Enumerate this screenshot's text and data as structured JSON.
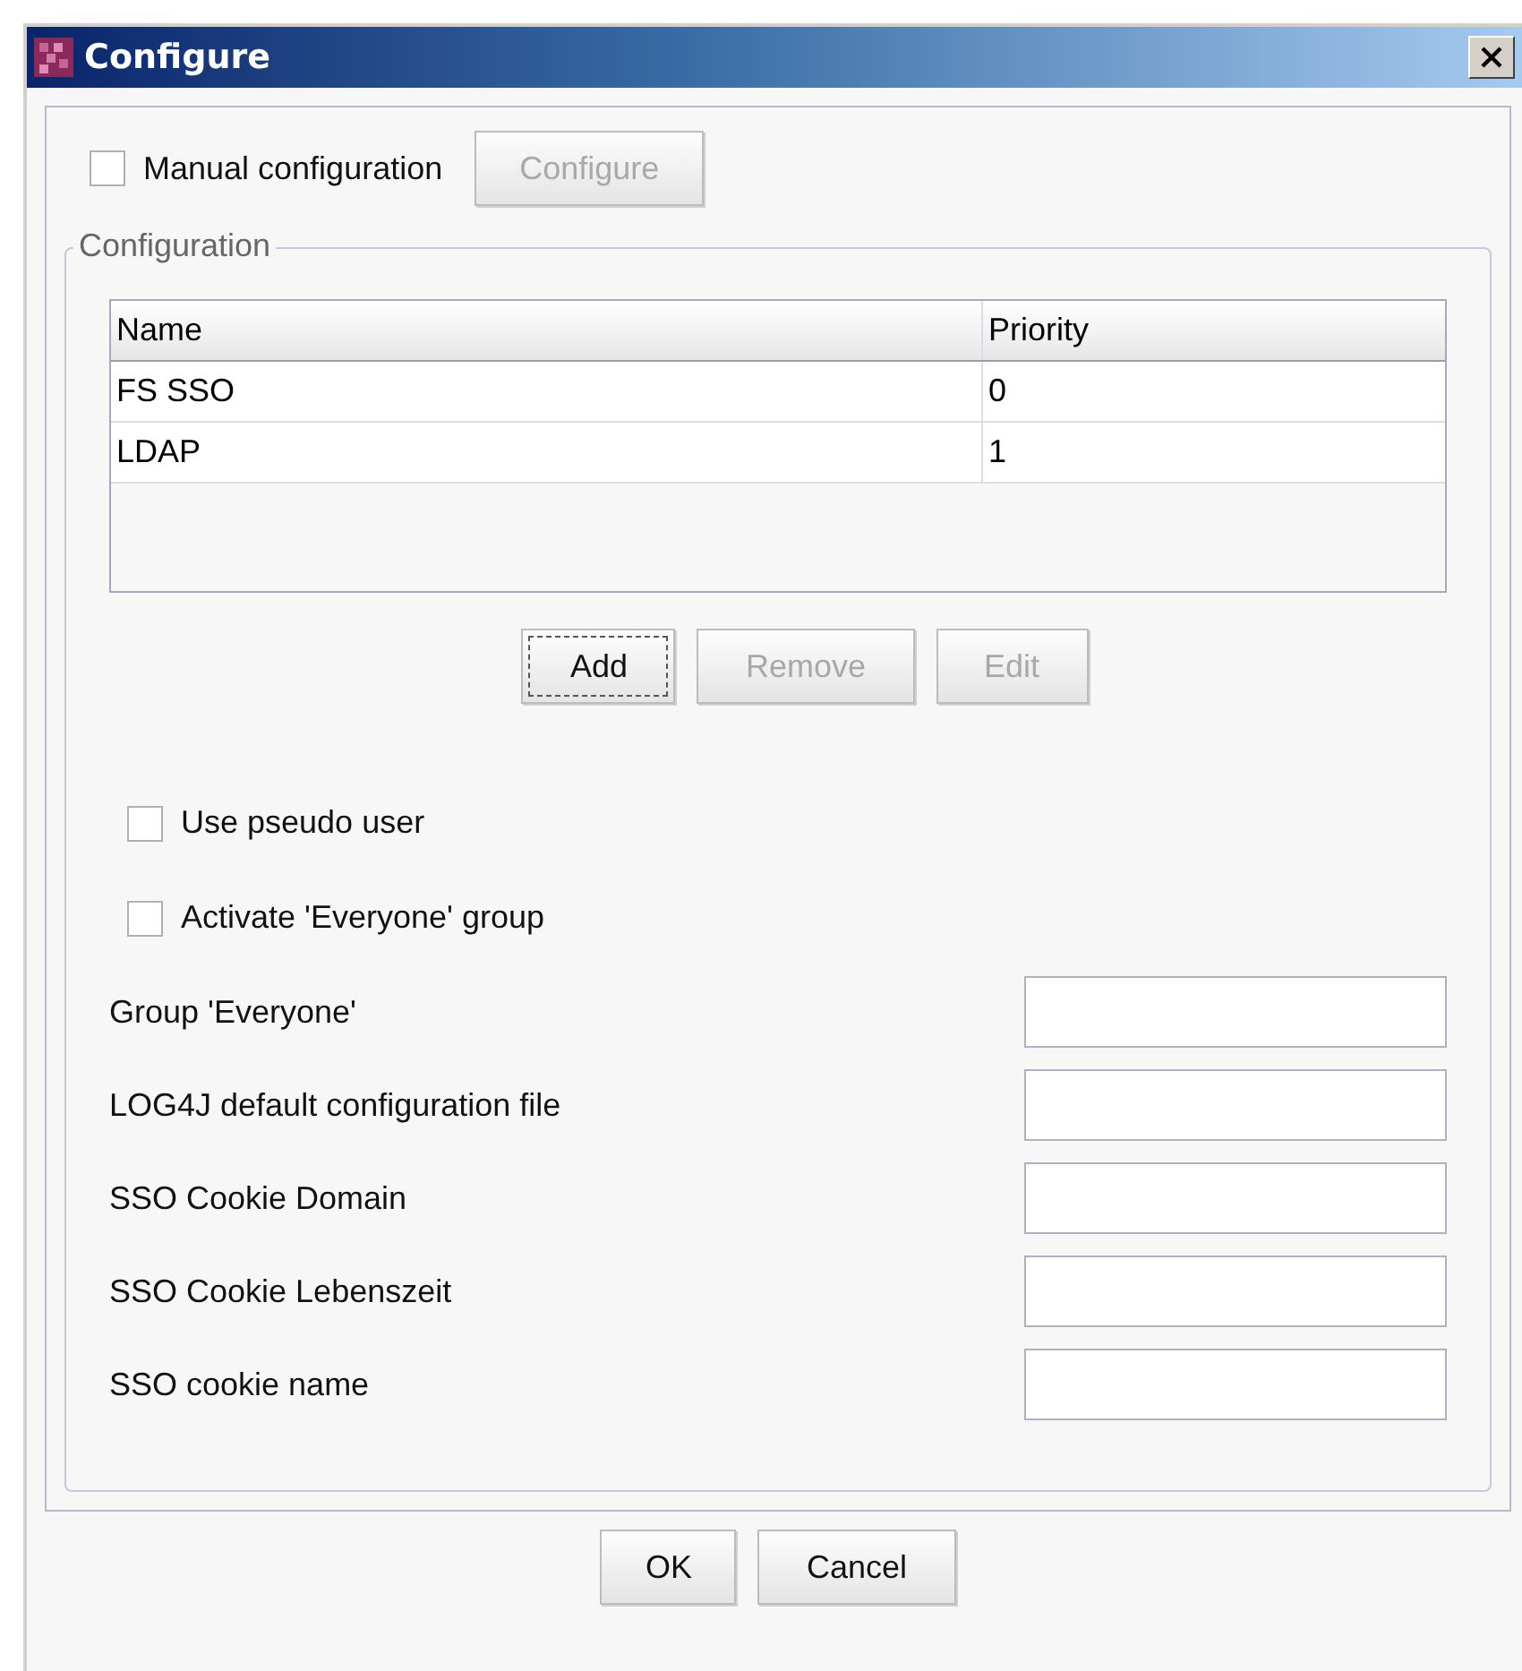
{
  "window": {
    "title": "Configure"
  },
  "manual": {
    "label": "Manual configuration",
    "checked": false,
    "button": {
      "label": "Configure",
      "disabled": true
    }
  },
  "configuration": {
    "title": "Configuration",
    "table": {
      "columns": [
        "Name",
        "Priority"
      ],
      "rows": [
        [
          "FS SSO",
          "0"
        ],
        [
          "LDAP",
          "1"
        ]
      ]
    },
    "buttons": [
      {
        "label": "Add",
        "disabled": false,
        "focused": true
      },
      {
        "label": "Remove",
        "disabled": true,
        "focused": false
      },
      {
        "label": "Edit",
        "disabled": true,
        "focused": false
      }
    ],
    "checkboxes": [
      {
        "label": "Use pseudo user",
        "checked": false
      },
      {
        "label": "Activate 'Everyone' group",
        "checked": false
      }
    ],
    "fields": [
      {
        "label": "Group 'Everyone'"
      },
      {
        "label": "LOG4J default configuration file"
      },
      {
        "label": "SSO Cookie Domain"
      },
      {
        "label": "SSO Cookie Lebenszeit"
      },
      {
        "label": "SSO cookie name"
      }
    ]
  },
  "dialog_buttons": [
    {
      "label": "OK"
    },
    {
      "label": "Cancel"
    }
  ]
}
